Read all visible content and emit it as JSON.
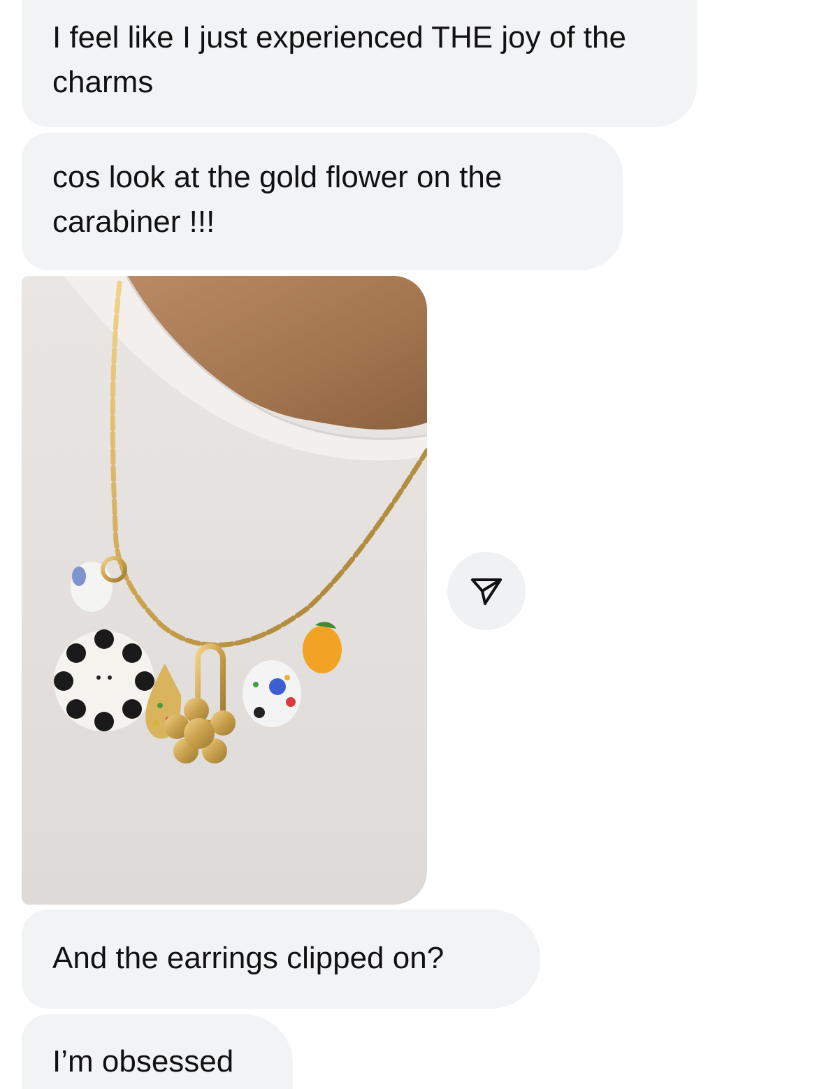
{
  "messages": [
    {
      "text": "I feel like I just experienced THE joy of the charms"
    },
    {
      "text": "cos look at the gold flower on the carabiner !!!"
    },
    {
      "text": "And the earrings clipped on?"
    },
    {
      "text": "I’m obsessed"
    }
  ],
  "icons": {
    "share": "paper-plane-icon"
  },
  "colors": {
    "bubble": "#f2f3f5",
    "text": "#111111",
    "share_button_bg": "#f0f1f3"
  }
}
